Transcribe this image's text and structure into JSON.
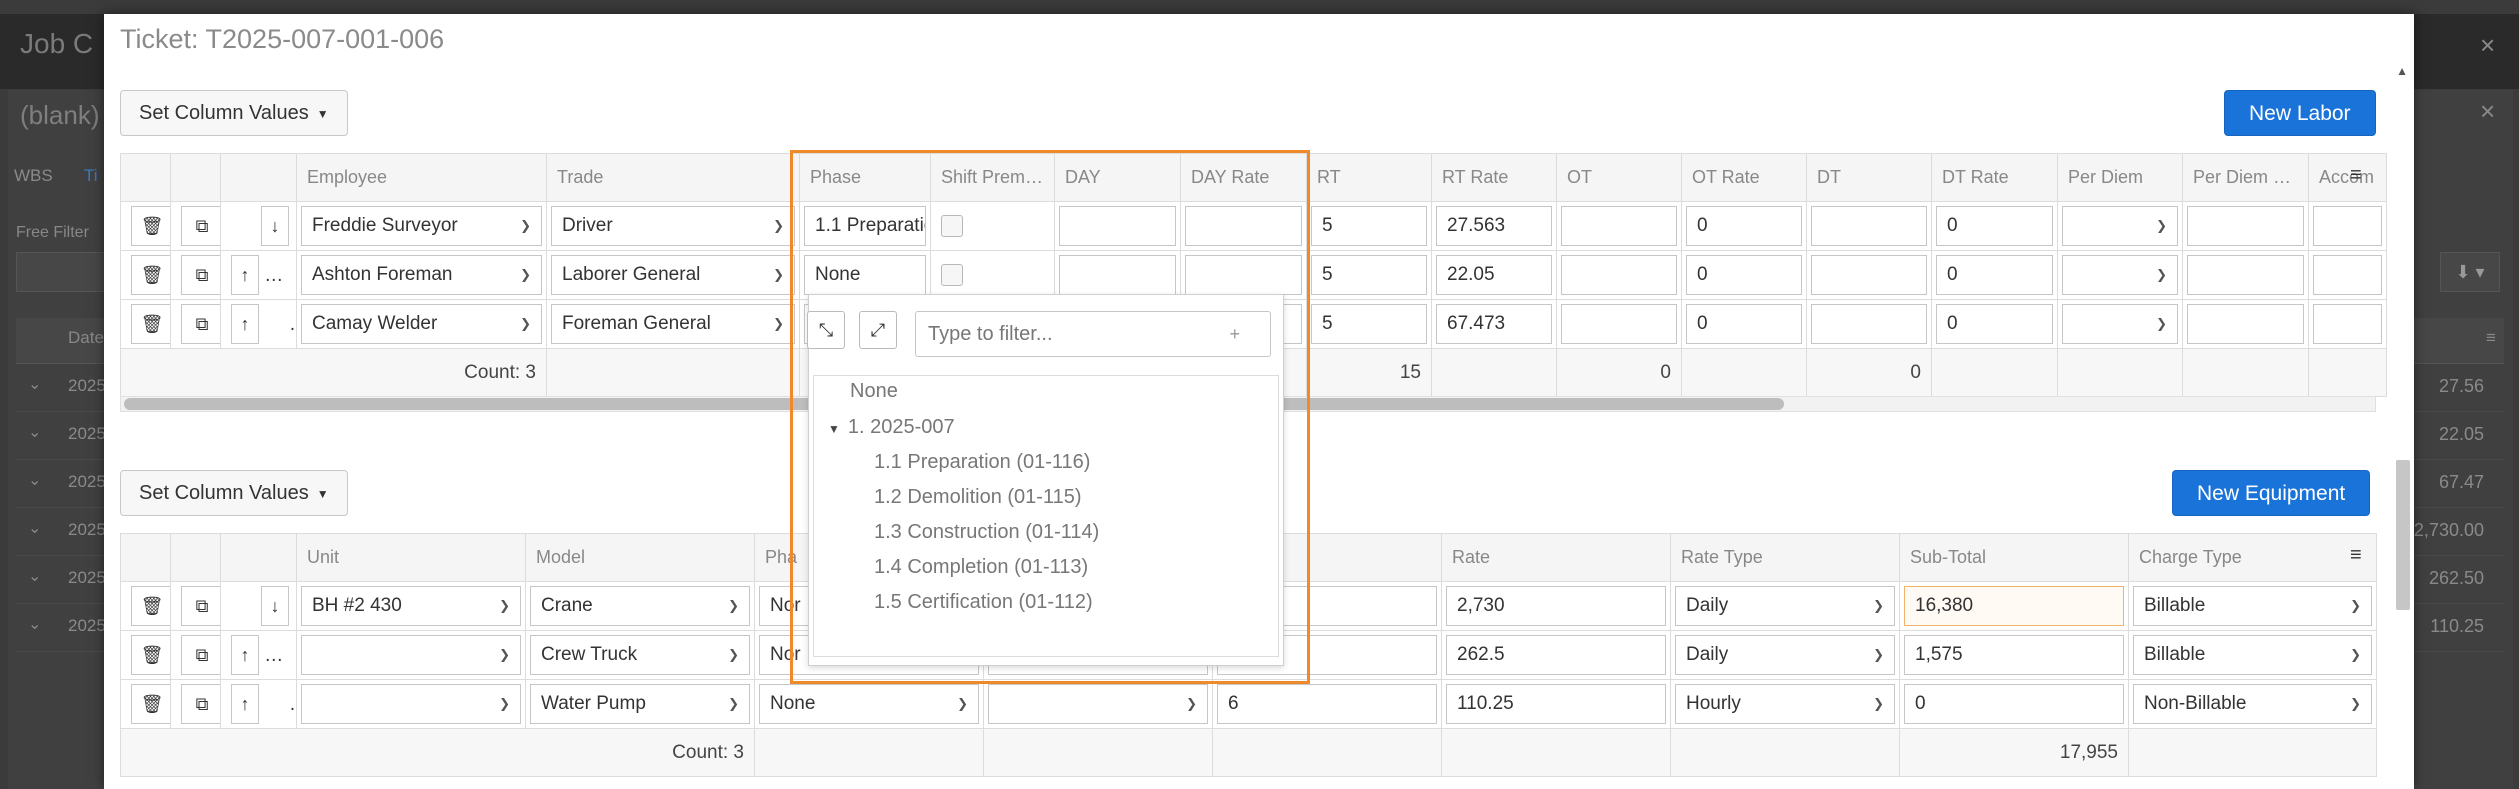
{
  "background": {
    "title": "Job C",
    "subtitle": "(blank)",
    "tabs": [
      "WBS",
      "Ti"
    ],
    "free_filter": "Free Filter",
    "date_header": "Date",
    "rows": [
      {
        "date": "2025",
        "value": "27.56"
      },
      {
        "date": "2025",
        "value": "22.05"
      },
      {
        "date": "2025",
        "value": "67.47"
      },
      {
        "date": "2025",
        "value": "2,730.00"
      },
      {
        "date": "2025",
        "value": "262.50"
      },
      {
        "date": "2025",
        "value": "110.25"
      }
    ]
  },
  "modal": {
    "title": "Ticket: T2025-007-001-006"
  },
  "labor": {
    "set_column_values": "Set Column Values",
    "new_button": "New Labor",
    "columns": [
      "Employee",
      "Trade",
      "Phase",
      "Shift Premi...",
      "DAY",
      "DAY Rate",
      "RT",
      "RT Rate",
      "OT",
      "OT Rate",
      "DT",
      "DT Rate",
      "Per Diem",
      "Per Diem R...",
      "Accom"
    ],
    "rows": [
      {
        "employee": "Freddie Surveyor",
        "trade": "Driver",
        "phase": "1.1 Preparatio",
        "rt": "5",
        "rt_rate": "27.563",
        "ot_rate": "0",
        "dt_rate": "0"
      },
      {
        "employee": "Ashton Foreman",
        "trade": "Laborer General",
        "phase": "None",
        "rt": "5",
        "rt_rate": "22.05",
        "ot_rate": "0",
        "dt_rate": "0"
      },
      {
        "employee": "Camay Welder",
        "trade": "Foreman General",
        "phase": "",
        "rt": "5",
        "rt_rate": "67.473",
        "ot_rate": "0",
        "dt_rate": "0"
      }
    ],
    "footer": {
      "count": "Count: 3",
      "rt_total": "15",
      "ot_total": "0",
      "dt_total": "0"
    }
  },
  "equipment": {
    "set_column_values": "Set Column Values",
    "new_button": "New Equipment",
    "columns": [
      "Unit",
      "Model",
      "Pha",
      "",
      "",
      "Rate",
      "Rate Type",
      "Sub-Total",
      "Charge Type"
    ],
    "rows": [
      {
        "unit": "BH #2 430",
        "model": "Crane",
        "phase": "Nor",
        "qty": "",
        "rate": "2,730",
        "rate_type": "Daily",
        "subtotal": "16,380",
        "charge_type": "Billable"
      },
      {
        "unit": "",
        "model": "Crew Truck",
        "phase": "Nor",
        "qty": "",
        "rate": "262.5",
        "rate_type": "Daily",
        "subtotal": "1,575",
        "charge_type": "Billable"
      },
      {
        "unit": "",
        "model": "Water Pump",
        "phase": "None",
        "qty": "6",
        "rate": "110.25",
        "rate_type": "Hourly",
        "subtotal": "0",
        "charge_type": "Non-Billable"
      }
    ],
    "footer": {
      "count": "Count: 3",
      "subtotal_total": "17,955"
    }
  },
  "phase_popup": {
    "filter_placeholder": "Type to filter...",
    "items": [
      {
        "label": "None",
        "level": 0
      },
      {
        "label": "1. 2025-007",
        "level": 0,
        "expanded": true
      },
      {
        "label": "1.1 Preparation (01-116)",
        "level": 1
      },
      {
        "label": "1.2 Demolition (01-115)",
        "level": 1
      },
      {
        "label": "1.3 Construction (01-114)",
        "level": 1
      },
      {
        "label": "1.4 Completion (01-113)",
        "level": 1
      },
      {
        "label": "1.5 Certification (01-112)",
        "level": 1
      }
    ]
  },
  "colors": {
    "primary": "#1a73d9",
    "highlight": "#ee8a2a"
  }
}
